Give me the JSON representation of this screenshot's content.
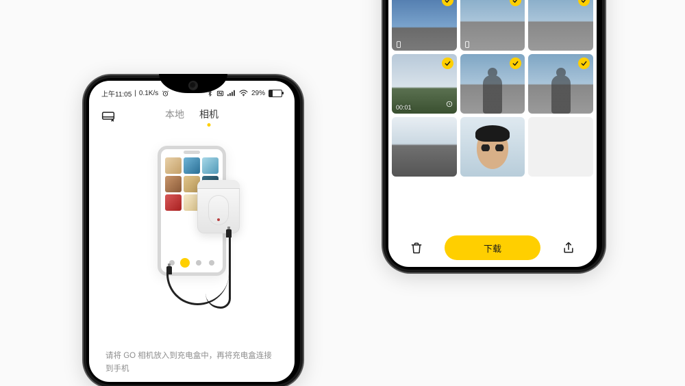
{
  "colors": {
    "accent": "#ffcf00"
  },
  "left": {
    "status": {
      "time": "上午11:05",
      "net_speed": "0.1K/s",
      "battery_pct": "29%"
    },
    "tabs": {
      "local": "本地",
      "camera": "相机",
      "active": "camera"
    },
    "hint": "请将 GO 相机放入到充电盒中，再将充电盒连接到手机"
  },
  "right": {
    "tiles": [
      {
        "selected": false,
        "kind": "partial-person"
      },
      {
        "selected": false,
        "kind": "partial-person"
      },
      {
        "selected": false,
        "kind": "partial-person"
      },
      {
        "selected": true,
        "kind": "sky-dark",
        "video": true
      },
      {
        "selected": true,
        "kind": "sky",
        "video": true
      },
      {
        "selected": true,
        "kind": "sky"
      },
      {
        "selected": true,
        "kind": "dusk",
        "duration": "00:01",
        "clock": true
      },
      {
        "selected": true,
        "kind": "person"
      },
      {
        "selected": true,
        "kind": "person"
      },
      {
        "selected": false,
        "kind": "city"
      },
      {
        "selected": false,
        "kind": "selfie"
      },
      {
        "selected": false,
        "kind": "blank"
      }
    ],
    "download_label": "下载"
  }
}
